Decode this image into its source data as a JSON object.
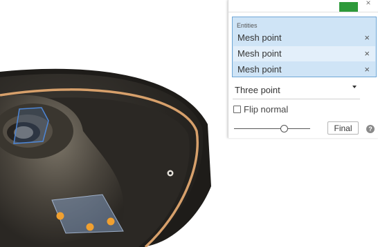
{
  "panel": {
    "entities_label": "Entities",
    "entities": [
      {
        "label": "Mesh point"
      },
      {
        "label": "Mesh point"
      },
      {
        "label": "Mesh point"
      }
    ],
    "method": {
      "selected": "Three point"
    },
    "flip_normal": {
      "label": "Flip normal",
      "checked": false
    },
    "slider_value": 0.68,
    "final_label": "Final",
    "help_glyph": "?",
    "remove_glyph": "×",
    "close_glyph": "×"
  },
  "colors": {
    "ok_button": "#2e9a3a",
    "selection_bg": "#cfe4f6",
    "selection_border": "#6ea6d6",
    "mesh_point": "#f0a030"
  },
  "icons": [
    "remove-icon",
    "chevron-down-icon",
    "help-icon",
    "close-icon",
    "checkmark-icon"
  ]
}
